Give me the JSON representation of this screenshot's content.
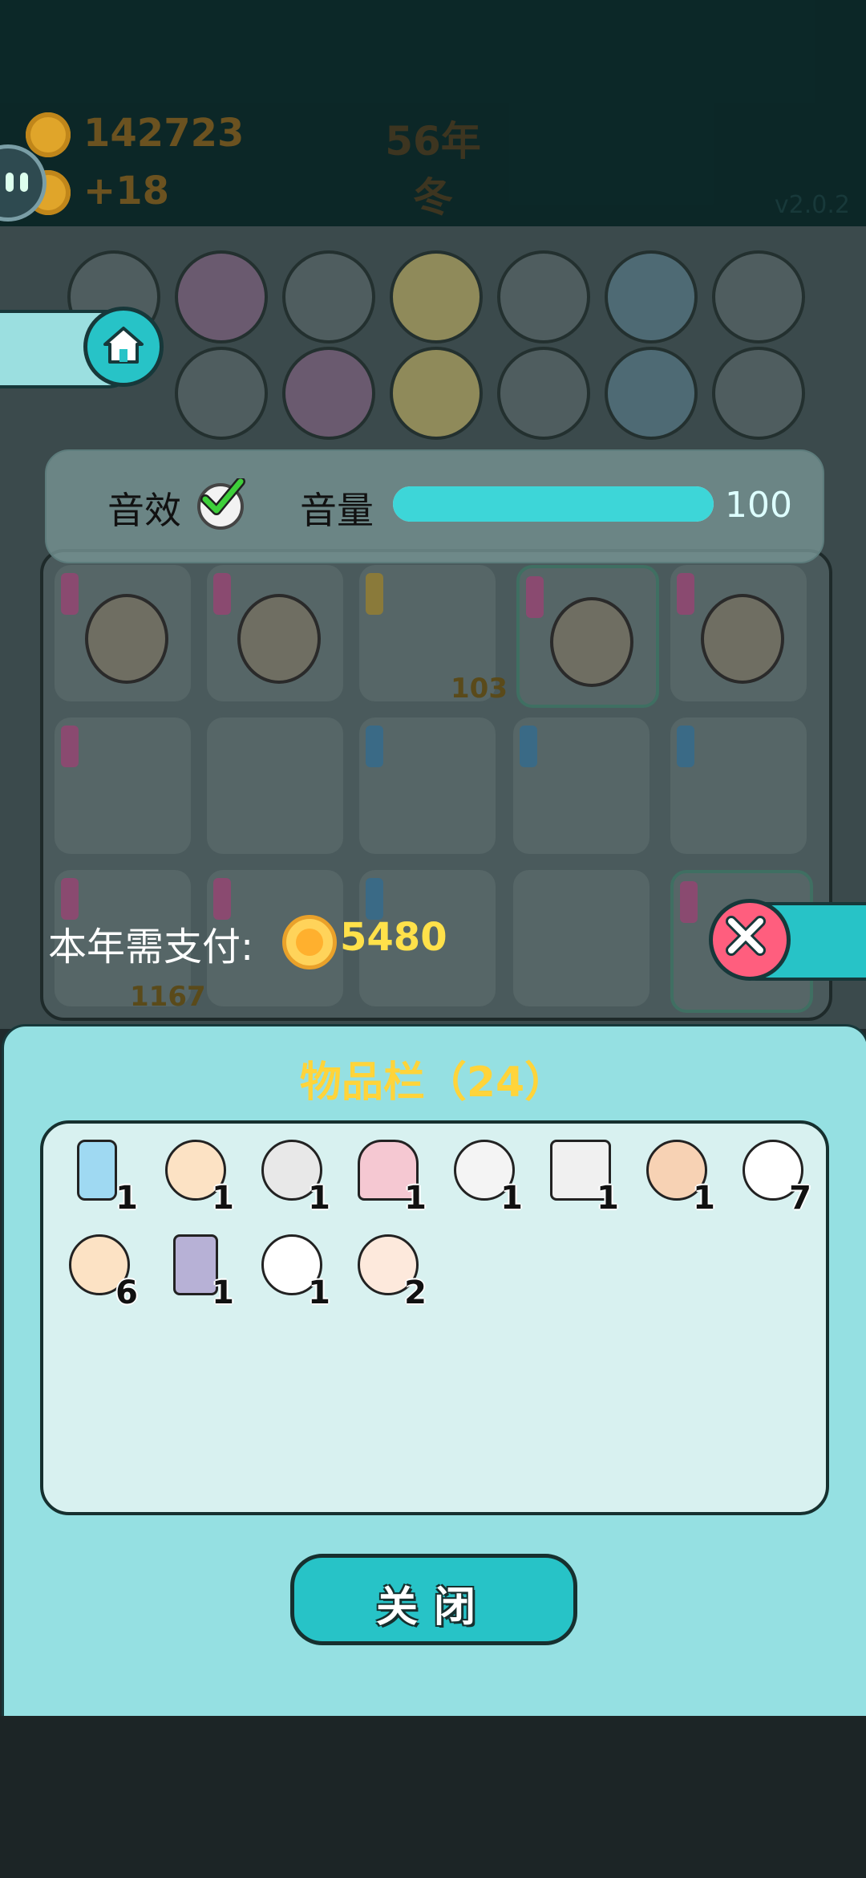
{
  "top": {
    "coins": "142723",
    "coin_delta": "+18",
    "year": "56年",
    "season": "冬",
    "version": "v2.0.2"
  },
  "settings": {
    "sound_label": "音效",
    "sound_enabled": true,
    "volume_label": "音量",
    "volume_value": "100",
    "volume_level": 1.0
  },
  "board": {
    "cell_counts": [
      "103",
      "1167"
    ]
  },
  "payment": {
    "label": "本年需支付:",
    "amount": "5480"
  },
  "inventory": {
    "title": "物品栏（24）",
    "items": [
      {
        "icon": "fridge-icon",
        "count": "1"
      },
      {
        "icon": "bald-glasses-gold-icon",
        "count": "1"
      },
      {
        "icon": "cap-man-icon",
        "count": "1"
      },
      {
        "icon": "shrine-icon",
        "count": "1"
      },
      {
        "icon": "husky-king-icon",
        "count": "1"
      },
      {
        "icon": "copy-paste-icon",
        "count": "1"
      },
      {
        "icon": "farmer-icon",
        "count": "1"
      },
      {
        "icon": "rabbit-icon",
        "count": "7"
      },
      {
        "icon": "bald-man-icon",
        "count": "6"
      },
      {
        "icon": "server-rack-icon",
        "count": "1"
      },
      {
        "icon": "horse-icon",
        "count": "1"
      },
      {
        "icon": "man-face-icon",
        "count": "2"
      }
    ],
    "close_label": "关闭"
  },
  "colors": {
    "accent": "#27c3c7",
    "panel": "#95e0e2",
    "gold": "#ffd43a",
    "danger": "#ff5e7e"
  }
}
